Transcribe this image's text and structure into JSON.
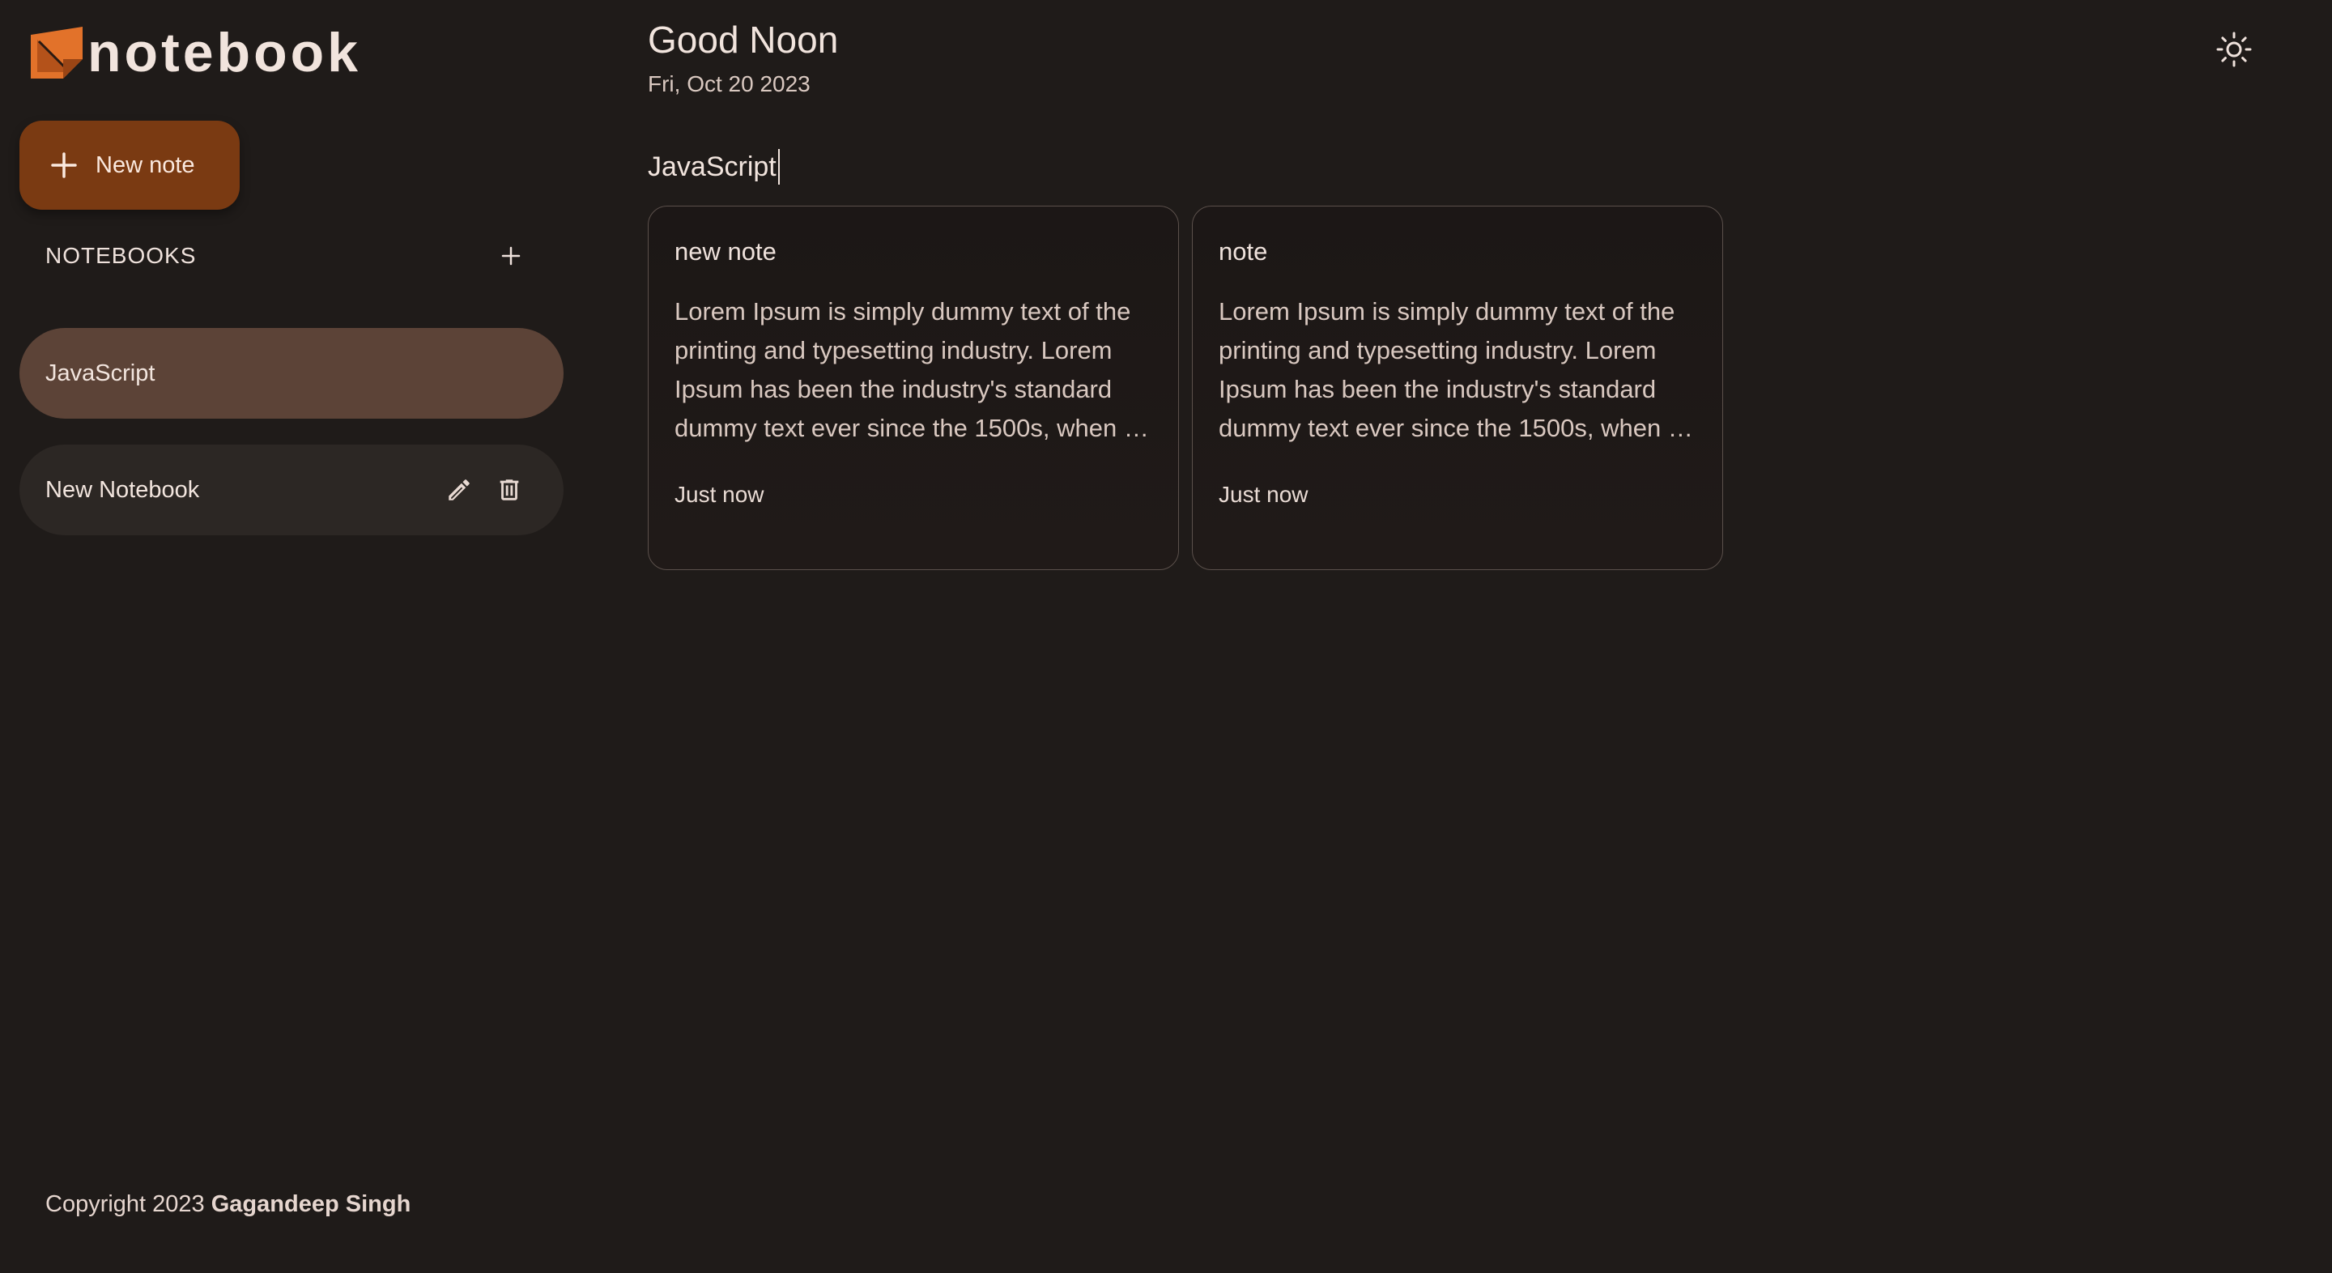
{
  "app": {
    "logo_text": "notebook",
    "brand_color": "#e2722a"
  },
  "sidebar": {
    "new_note_label": "New note",
    "notebooks_header": "NOTEBOOKS",
    "notebooks": [
      {
        "label": "JavaScript",
        "active": true
      },
      {
        "label": "New Notebook",
        "active": false
      }
    ],
    "copyright_prefix": "Copyright 2023",
    "copyright_author": "Gagandeep Singh"
  },
  "main": {
    "greeting": "Good Noon",
    "date": "Fri, Oct 20 2023",
    "notebook_title": "JavaScript",
    "notes": [
      {
        "title": "new note",
        "body": "Lorem Ipsum is simply dummy text of the printing and typesetting industry. Lorem Ipsum has been the industry's standard dummy text ever since the 1500s, when an unknown printer took a galley of type and scrambled it to make a type specimen book.",
        "time": "Just now"
      },
      {
        "title": "note",
        "body": "Lorem Ipsum is simply dummy text of the printing and typesetting industry. Lorem Ipsum has been the industry's standard dummy text ever since the 1500s, when an unknown printer took a galley of type and scrambled it to make a type specimen book.",
        "time": "Just now"
      }
    ]
  },
  "icons": {
    "logo": "notebook-logo-icon",
    "new_note": "plus-icon",
    "add_notebook": "plus-icon",
    "edit": "pencil-icon",
    "delete": "trash-icon",
    "theme": "sun-icon"
  },
  "colors": {
    "background": "#1f1b19",
    "accent_button": "#7a3a12",
    "active_notebook": "#5c4337",
    "inactive_notebook": "#2c2724"
  }
}
